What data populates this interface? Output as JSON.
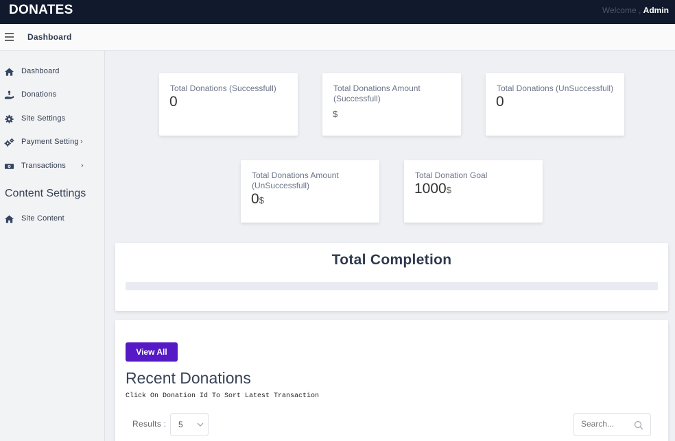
{
  "app": {
    "brand": "DONATES",
    "welcome_label": "Welcome ,",
    "user_name": "Admin"
  },
  "subheader": {
    "title": "Dashboard"
  },
  "sidebar": {
    "items": [
      {
        "label": "Dashboard",
        "icon": "home-icon"
      },
      {
        "label": "Donations",
        "icon": "donate-hand-icon"
      },
      {
        "label": "Site Settings",
        "icon": "gear-icon"
      },
      {
        "label": "Payment Setting",
        "icon": "gears-icon",
        "chevron": "›"
      },
      {
        "label": "Transactions",
        "icon": "money-bill-icon",
        "chevron": "›"
      }
    ],
    "section_heading": "Content Settings",
    "section_items": [
      {
        "label": "Site Content",
        "icon": "home-icon"
      }
    ]
  },
  "stats": [
    {
      "label": "Total Donations (Successfull)",
      "value": "0",
      "unit": ""
    },
    {
      "label": "Total Donations Amount (Successfull)",
      "value": "",
      "unit": "$"
    },
    {
      "label": "Total Donations (UnSuccessfull)",
      "value": "0",
      "unit": ""
    },
    {
      "label": "Total Donations Amount (UnSuccessfull)",
      "value": "0",
      "unit": "$"
    },
    {
      "label": "Total Donation Goal",
      "value": "1000",
      "unit": "$"
    }
  ],
  "completion": {
    "title": "Total Completion",
    "progress_percent": 0
  },
  "recent": {
    "view_all_label": "View All",
    "title": "Recent Donations",
    "subtitle": "Click On Donation Id To Sort Latest Transaction",
    "results_label": "Results :",
    "results_value": "5",
    "search_placeholder": "Search..."
  },
  "colors": {
    "topbar": "#111a2c",
    "accent": "#5519c5",
    "icon": "#34455f"
  }
}
